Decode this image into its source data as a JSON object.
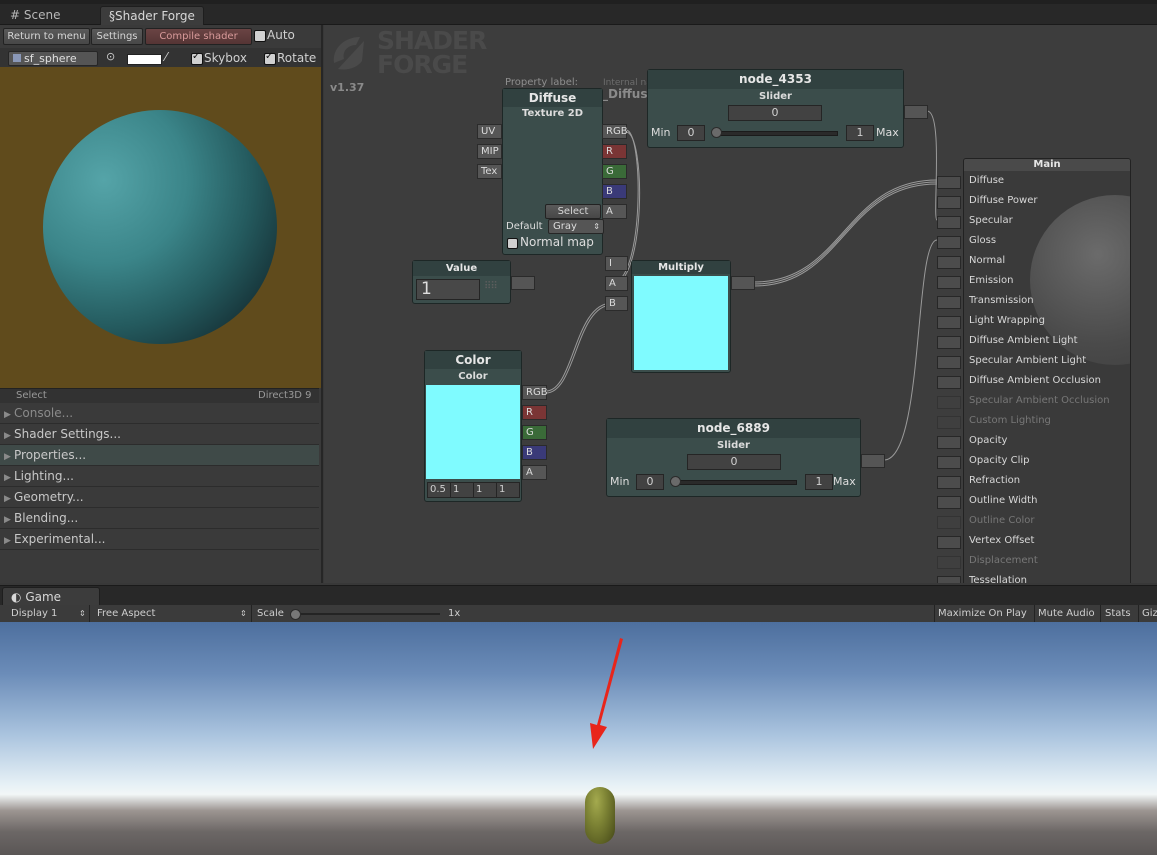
{
  "tabs": {
    "scene": "Scene",
    "shader_forge": "Shader Forge"
  },
  "toolbar": {
    "return": "Return to menu",
    "settings": "Settings",
    "compile": "Compile shader",
    "auto": "Auto",
    "auto_checked": false
  },
  "preview": {
    "mesh": "sf_sphere",
    "skybox": "Skybox",
    "rotate": "Rotate",
    "select": "Select",
    "renderer": "Direct3D 9"
  },
  "sections": [
    "Console...",
    "Shader Settings...",
    "Properties...",
    "Lighting...",
    "Geometry...",
    "Blending...",
    "Experimental..."
  ],
  "logo": {
    "line1": "SHADER",
    "line2": "FORGE",
    "version": "v1.37"
  },
  "texture_node": {
    "property_label": "Property label:",
    "internal_name": "Internal name:",
    "internal_value": "_Diffuse",
    "title": "Diffuse",
    "subtitle": "Texture 2D",
    "inputs": [
      "UV",
      "MIP",
      "Tex"
    ],
    "outputs": [
      {
        "label": "RGB",
        "color": "#565656"
      },
      {
        "label": "R",
        "color": "#7a3535"
      },
      {
        "label": "G",
        "color": "#3a6a38"
      },
      {
        "label": "B",
        "color": "#3a3a78"
      },
      {
        "label": "A",
        "color": "#565656"
      }
    ],
    "select": "Select",
    "default_label": "Default",
    "default_value": "Gray",
    "normal_map": "Normal map"
  },
  "slider1": {
    "title": "node_4353",
    "subtitle": "Slider",
    "value": "0",
    "min_label": "Min",
    "min": "0",
    "max": "1",
    "max_label": "Max"
  },
  "slider2": {
    "title": "node_6889",
    "subtitle": "Slider",
    "value": "0",
    "min_label": "Min",
    "min": "0",
    "max": "1",
    "max_label": "Max"
  },
  "value_node": {
    "title": "Value",
    "value": "1"
  },
  "multiply_node": {
    "title": "Multiply",
    "inputs": [
      "A",
      "B"
    ],
    "swatch": "#7ffbff"
  },
  "color_node": {
    "title": "Color",
    "subtitle": "Color",
    "swatch": "#7ffbff",
    "outputs": [
      {
        "label": "RGB",
        "color": "#565656"
      },
      {
        "label": "R",
        "color": "#7a3535"
      },
      {
        "label": "G",
        "color": "#3a6a38"
      },
      {
        "label": "B",
        "color": "#3a3a78"
      },
      {
        "label": "A",
        "color": "#565656"
      }
    ],
    "values": [
      "0.5",
      "1",
      "1",
      "1"
    ]
  },
  "main_node": {
    "title": "Main",
    "inputs": [
      {
        "label": "Diffuse",
        "enabled": true
      },
      {
        "label": "Diffuse Power",
        "enabled": true
      },
      {
        "label": "Specular",
        "enabled": true
      },
      {
        "label": "Gloss",
        "enabled": true
      },
      {
        "label": "Normal",
        "enabled": true
      },
      {
        "label": "Emission",
        "enabled": true
      },
      {
        "label": "Transmission",
        "enabled": true
      },
      {
        "label": "Light Wrapping",
        "enabled": true
      },
      {
        "label": "Diffuse Ambient Light",
        "enabled": true
      },
      {
        "label": "Specular Ambient Light",
        "enabled": true
      },
      {
        "label": "Diffuse Ambient Occlusion",
        "enabled": true
      },
      {
        "label": "Specular Ambient Occlusion",
        "enabled": false
      },
      {
        "label": "Custom Lighting",
        "enabled": false
      },
      {
        "label": "Opacity",
        "enabled": true
      },
      {
        "label": "Opacity Clip",
        "enabled": true
      },
      {
        "label": "Refraction",
        "enabled": true
      },
      {
        "label": "Outline Width",
        "enabled": true
      },
      {
        "label": "Outline Color",
        "enabled": false
      },
      {
        "label": "Vertex Offset",
        "enabled": true
      },
      {
        "label": "Displacement",
        "enabled": false
      },
      {
        "label": "Tessellation",
        "enabled": true
      }
    ]
  },
  "game": {
    "tab": "Game",
    "display": "Display 1",
    "aspect": "Free Aspect",
    "scale_label": "Scale",
    "scale_value": "1x",
    "maximize": "Maximize On Play",
    "mute": "Mute Audio",
    "stats": "Stats",
    "gizmos": "Giz"
  },
  "colors": {
    "accent_arrow": "#e8251b",
    "preview_bg": "#604b1c",
    "node_body": "#3b4d4b"
  }
}
